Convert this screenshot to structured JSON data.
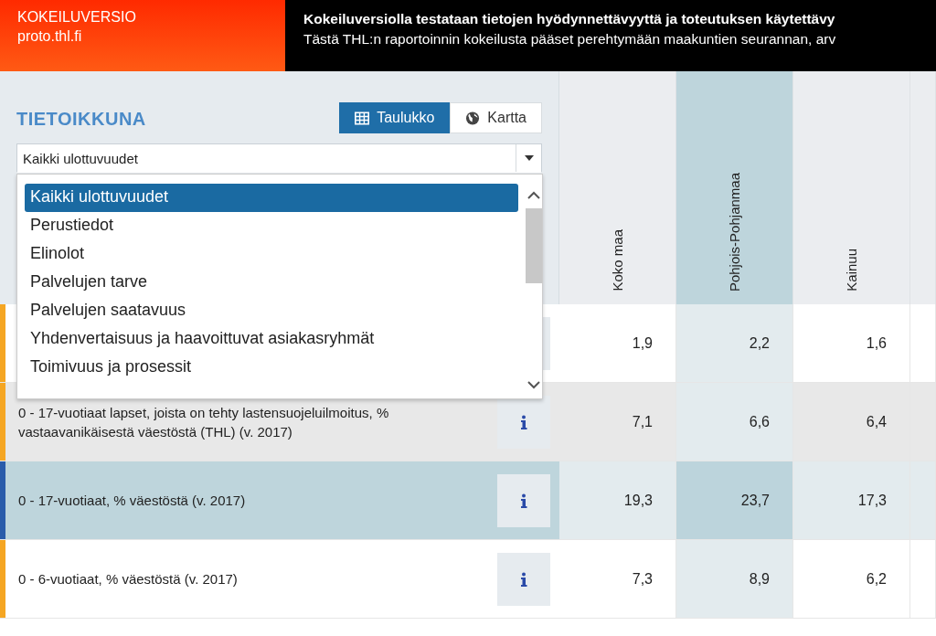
{
  "banner": {
    "badge": "KOKEILUVERSIO",
    "site": "proto.thl.fi",
    "headline": "Kokeiluversiolla testataan tietojen hyödynnettävyyttä ja toteutuksen käytettävy",
    "subline": "Tästä THL:n raportoinnin kokeilusta pääset perehtymään maakuntien seurannan, arv"
  },
  "panel": {
    "title": "TIETOIKKUNA",
    "view_toggle": [
      {
        "label": "Taulukko",
        "kind": "table",
        "selected": true
      },
      {
        "label": "Kartta",
        "kind": "map",
        "selected": false
      }
    ],
    "dimension_select": {
      "value": "Kaikki ulottuvuudet",
      "expanded": true,
      "options": [
        {
          "label": "Kaikki ulottuvuudet",
          "selected": true
        },
        {
          "label": "Perustiedot",
          "selected": false
        },
        {
          "label": "Elinolot",
          "selected": false
        },
        {
          "label": "Palvelujen tarve",
          "selected": false
        },
        {
          "label": "Palvelujen saatavuus",
          "selected": false
        },
        {
          "label": "Yhdenvertaisuus ja haavoittuvat asiakasryhmät",
          "selected": false
        },
        {
          "label": "Toimivuus ja prosessit",
          "selected": false
        }
      ]
    }
  },
  "table": {
    "columns": [
      {
        "name": "Koko maa",
        "selected": false
      },
      {
        "name": "Pohjois-Pohjanmaa",
        "selected": true
      },
      {
        "name": "Kainuu",
        "selected": false
      }
    ],
    "rows": [
      {
        "color": "#f5a623",
        "selected": false,
        "hovered": false,
        "values": [
          "1,9",
          "2,2",
          "1,6"
        ]
      },
      {
        "label": "0 - 17-vuotiaat lapset, joista on tehty lastensuojeluilmoitus, % vastaavanikäisestä väestöstä (THL) (v. 2017)",
        "color": "#f5a623",
        "selected": false,
        "hovered": true,
        "values": [
          "7,1",
          "6,6",
          "6,4"
        ]
      },
      {
        "label": "0 - 17-vuotiaat, % väestöstä (v. 2017)",
        "color": "#2a5caa",
        "selected": true,
        "hovered": false,
        "values": [
          "19,3",
          "23,7",
          "17,3"
        ]
      },
      {
        "label": "0 - 6-vuotiaat, % väestöstä (v. 2017)",
        "color": "#f5a623",
        "selected": false,
        "hovered": false,
        "values": [
          "7,3",
          "8,9",
          "6,2"
        ]
      }
    ]
  }
}
